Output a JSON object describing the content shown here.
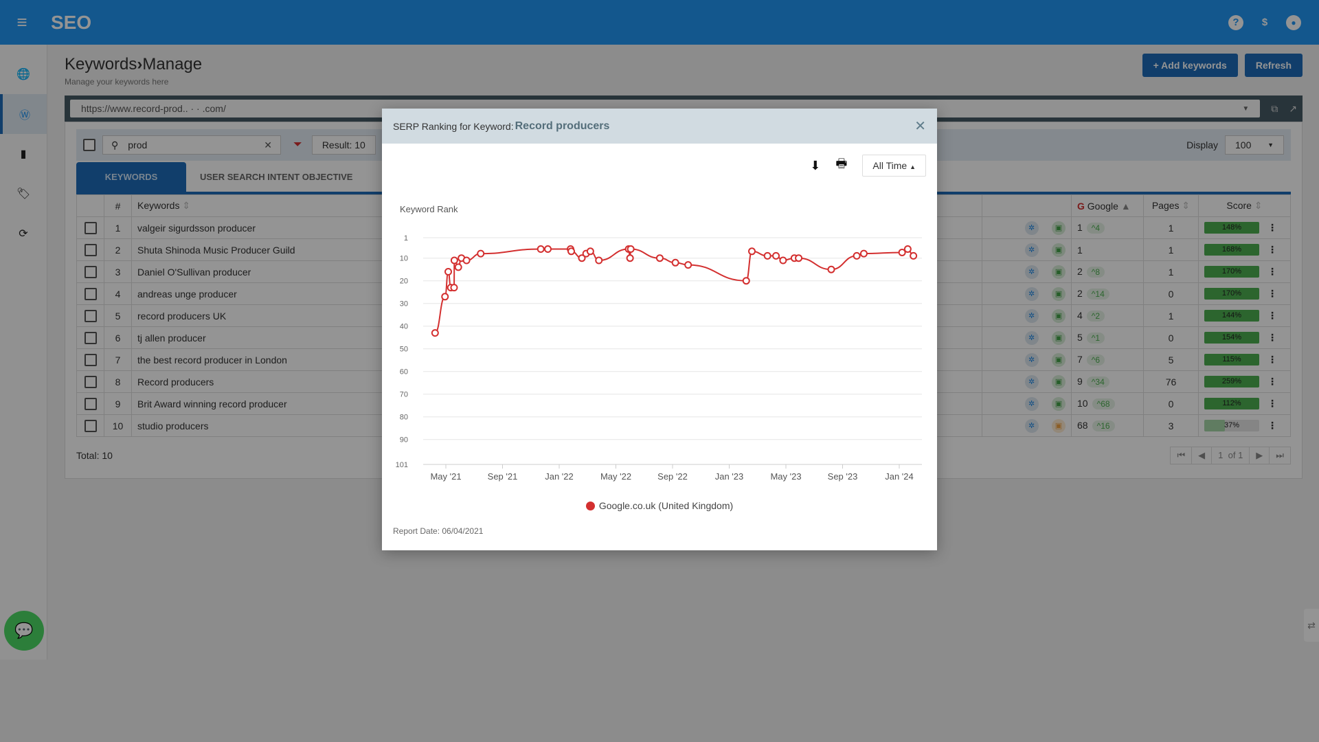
{
  "topbar": {
    "brand": "SEO",
    "menu_icon": "≡",
    "help_icon": "?",
    "billing_icon": "$",
    "account_icon": "👤"
  },
  "sidebar": {
    "items": [
      {
        "name": "globe",
        "glyph": "🌐"
      },
      {
        "name": "wordpress",
        "glyph": "Ⓦ",
        "active": true
      },
      {
        "name": "document",
        "glyph": "▮"
      },
      {
        "name": "tag",
        "glyph": "🏷"
      },
      {
        "name": "sync",
        "glyph": "⟳"
      }
    ]
  },
  "header": {
    "title": "Keywords",
    "separator": "›",
    "subtitle_page": "Manage",
    "description": "Manage your keywords here",
    "add_keywords": "Add keywords",
    "add_icon": "+",
    "refresh": "Refresh"
  },
  "urlbar": {
    "url": "https://www.record-prod.. · · .com/",
    "copy_icon": "⧉",
    "open_icon": "↗"
  },
  "filter": {
    "search_value": "prod",
    "search_icon": "🔍",
    "clear_icon": "✕",
    "clear_filter_icon": "⏷",
    "result": "Result: 10",
    "display_label": "Display",
    "display_value": "100"
  },
  "tabs": [
    {
      "label": "KEYWORDS"
    },
    {
      "label": "USER SEARCH INTENT OBJECTIVE"
    }
  ],
  "table": {
    "headers": {
      "num": "#",
      "keywords": "Keywords",
      "google": "Google",
      "pages": "Pages",
      "score": "Score"
    },
    "rows": [
      {
        "n": "1",
        "keyword": "valgeir sigurdsson producer",
        "rank": "1",
        "change": "^4",
        "pages": "1",
        "score": "148%",
        "score_pct": 100,
        "chart_color": "green"
      },
      {
        "n": "2",
        "keyword": "Shuta Shinoda Music Producer Guild",
        "rank": "1",
        "change": "",
        "pages": "1",
        "score": "168%",
        "score_pct": 100,
        "chart_color": "green"
      },
      {
        "n": "3",
        "keyword": "Daniel O'Sullivan producer",
        "rank": "2",
        "change": "^8",
        "pages": "1",
        "score": "170%",
        "score_pct": 100,
        "chart_color": "green"
      },
      {
        "n": "4",
        "keyword": "andreas unge producer",
        "rank": "2",
        "change": "^14",
        "pages": "0",
        "score": "170%",
        "score_pct": 100,
        "chart_color": "green"
      },
      {
        "n": "5",
        "keyword": "record producers UK",
        "rank": "4",
        "change": "^2",
        "pages": "1",
        "score": "144%",
        "score_pct": 100,
        "chart_color": "green"
      },
      {
        "n": "6",
        "keyword": "tj allen producer",
        "rank": "5",
        "change": "^1",
        "pages": "0",
        "score": "154%",
        "score_pct": 100,
        "chart_color": "green"
      },
      {
        "n": "7",
        "keyword": "the best record producer in London",
        "rank": "7",
        "change": "^6",
        "pages": "5",
        "score": "115%",
        "score_pct": 100,
        "chart_color": "green"
      },
      {
        "n": "8",
        "keyword": "Record producers",
        "rank": "9",
        "change": "^34",
        "pages": "76",
        "score": "259%",
        "score_pct": 100,
        "chart_color": "green"
      },
      {
        "n": "9",
        "keyword": "Brit Award winning record producer",
        "rank": "10",
        "change": "^68",
        "pages": "0",
        "score": "112%",
        "score_pct": 100,
        "chart_color": "green"
      },
      {
        "n": "10",
        "keyword": "studio producers",
        "rank": "68",
        "change": "^16",
        "pages": "3",
        "score": "37%",
        "score_pct": 37,
        "chart_color": "orange"
      }
    ],
    "total": "Total: 10",
    "pager": {
      "page": "1",
      "of": "of 1"
    }
  },
  "modal": {
    "title_prefix": "SERP Ranking for Keyword:",
    "keyword": "Record producers",
    "close_icon": "✕",
    "download_icon": "⬇",
    "print_icon": "🖶",
    "range": "All Time",
    "report_date": "Report Date: 06/04/2021"
  },
  "chart_data": {
    "type": "line",
    "title": "Keyword Rank",
    "xlabel": "",
    "ylabel": "Keyword Rank",
    "y_reversed": true,
    "ylim": [
      1,
      101
    ],
    "y_ticks": [
      1,
      10,
      20,
      30,
      40,
      50,
      60,
      70,
      80,
      90,
      101
    ],
    "x_ticks": [
      "May '21",
      "Sep '21",
      "Jan '22",
      "May '22",
      "Sep '22",
      "Jan '23",
      "May '23",
      "Sep '23",
      "Jan '24"
    ],
    "x_unit": "months since May 2021",
    "xlim": [
      -1.6,
      33.6
    ],
    "grid": true,
    "legend": "bottom",
    "series": [
      {
        "name": "Google.co.uk (United Kingdom)",
        "color": "#d32f2f",
        "points": [
          [
            -0.76,
            43
          ],
          [
            -0.06,
            27
          ],
          [
            0.17,
            16
          ],
          [
            0.35,
            23
          ],
          [
            0.58,
            23
          ],
          [
            0.6,
            11
          ],
          [
            0.88,
            14
          ],
          [
            1.1,
            10
          ],
          [
            1.46,
            11
          ],
          [
            2.46,
            8
          ],
          [
            6.7,
            6
          ],
          [
            7.2,
            6
          ],
          [
            8.8,
            6
          ],
          [
            8.85,
            7
          ],
          [
            9.6,
            10
          ],
          [
            9.9,
            8
          ],
          [
            10.2,
            7
          ],
          [
            10.8,
            11
          ],
          [
            12.9,
            6
          ],
          [
            13.0,
            10
          ],
          [
            13.05,
            6
          ],
          [
            15.1,
            10
          ],
          [
            16.2,
            12
          ],
          [
            17.1,
            13
          ],
          [
            21.2,
            20
          ],
          [
            21.6,
            7
          ],
          [
            22.7,
            9
          ],
          [
            23.3,
            9
          ],
          [
            23.8,
            11
          ],
          [
            24.6,
            10
          ],
          [
            24.9,
            10
          ],
          [
            27.2,
            15
          ],
          [
            29.0,
            9
          ],
          [
            29.5,
            8
          ],
          [
            32.2,
            7.5
          ],
          [
            32.6,
            6
          ],
          [
            33.0,
            9
          ]
        ]
      }
    ]
  },
  "widgets": {
    "chat_icon": "💬",
    "side_tab_icon": "⇄"
  }
}
